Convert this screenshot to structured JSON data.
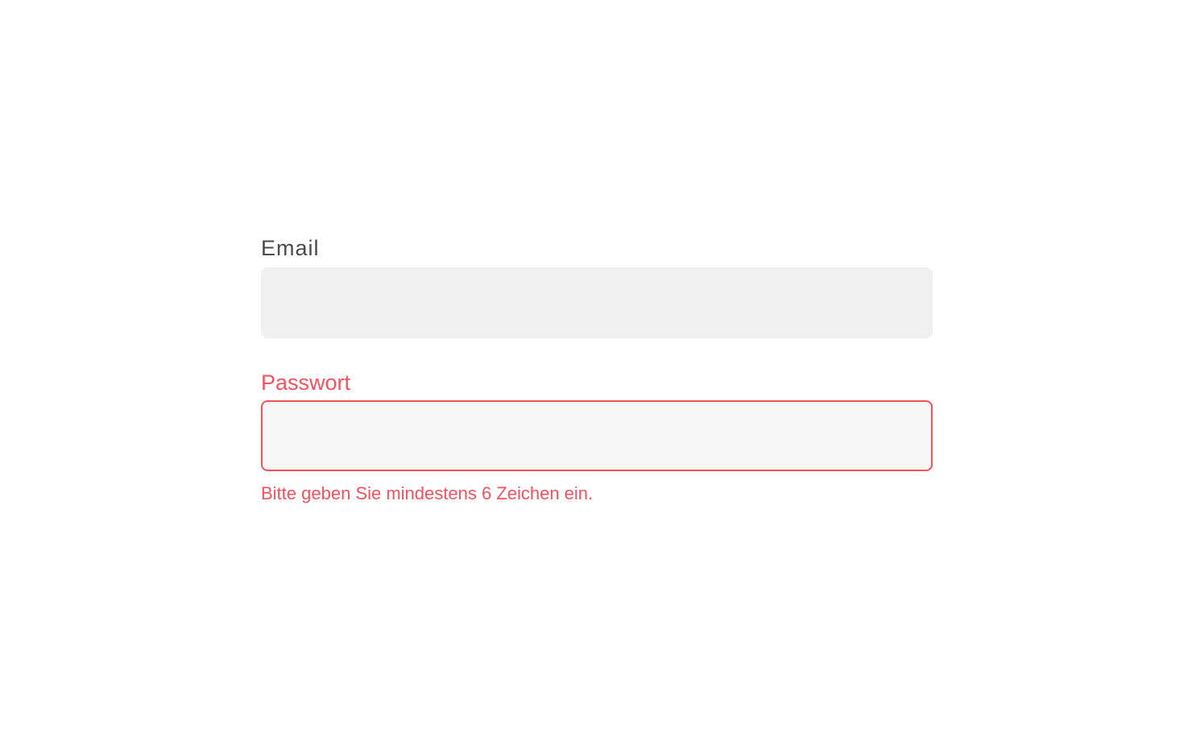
{
  "form": {
    "email": {
      "label": "Email",
      "value": "",
      "placeholder": ""
    },
    "password": {
      "label": "Passwort",
      "value": "",
      "placeholder": "",
      "error": "Bitte geben Sie mindestens 6 Zeichen ein."
    }
  },
  "colors": {
    "error": "#f4525f",
    "label": "#4a4a4a",
    "input_background": "#f0f0f0"
  }
}
